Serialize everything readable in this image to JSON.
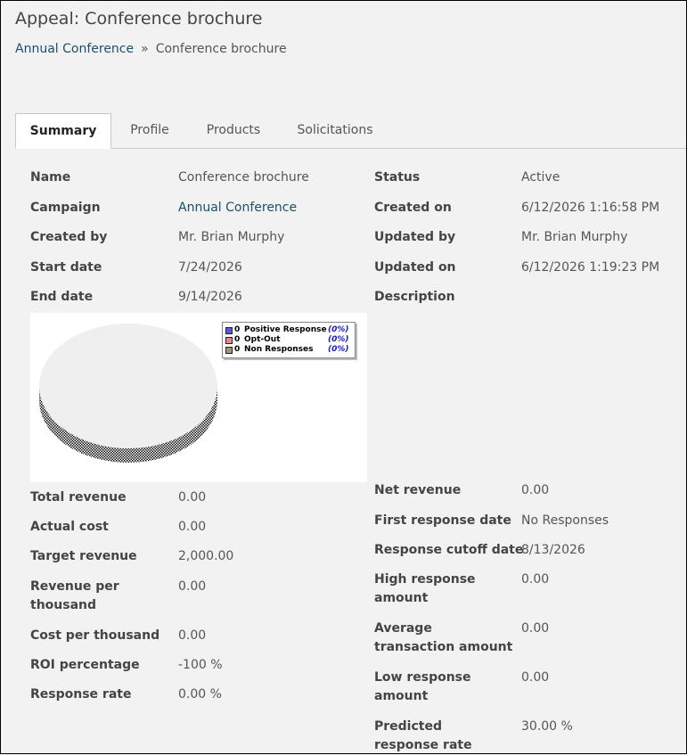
{
  "page": {
    "title": "Appeal: Conference brochure",
    "breadcrumb": {
      "parent": "Annual Conference",
      "separator": "»",
      "current": "Conference brochure"
    }
  },
  "tabs": [
    "Summary",
    "Profile",
    "Products",
    "Solicitations"
  ],
  "active_tab": "Summary",
  "fields_top_left": [
    {
      "label": "Name",
      "value": "Conference brochure"
    },
    {
      "label": "Campaign",
      "value": "Annual Conference"
    },
    {
      "label": "Created by",
      "value": "Mr. Brian Murphy"
    },
    {
      "label": "Start date",
      "value": "7/24/2026"
    },
    {
      "label": "End date",
      "value": "9/14/2026"
    }
  ],
  "fields_top_right": [
    {
      "label": "Status",
      "value": "Active"
    },
    {
      "label": "Created on",
      "value": "6/12/2026 1:16:58 PM"
    },
    {
      "label": "Updated by",
      "value": "Mr. Brian Murphy"
    },
    {
      "label": "Updated on",
      "value": "6/12/2026 1:19:23 PM"
    },
    {
      "label": "Description",
      "value": ""
    }
  ],
  "chart_legend": [
    {
      "count": "0",
      "label": "Positive Response",
      "pct": "(0%)",
      "color": "#5a5ad6"
    },
    {
      "count": "0",
      "label": "Opt-Out",
      "pct": "(0%)",
      "color": "#e8888a"
    },
    {
      "count": "0",
      "label": "Non Responses",
      "pct": "(0%)",
      "color": "#9a9a70"
    }
  ],
  "chart_data": {
    "type": "pie",
    "categories": [
      "Positive Response",
      "Opt-Out",
      "Non Responses"
    ],
    "values": [
      0,
      0,
      0
    ],
    "percentages": [
      "0%",
      "0%",
      "0%"
    ],
    "title": "",
    "legend_position": "top-right"
  },
  "fields_bottom_left": [
    {
      "label": "Total revenue",
      "value": "0.00"
    },
    {
      "label": "Actual cost",
      "value": "0.00"
    },
    {
      "label": "Target revenue",
      "value": "2,000.00"
    },
    {
      "label": "Revenue per thousand",
      "value": "0.00"
    },
    {
      "label": "Cost per thousand",
      "value": "0.00"
    },
    {
      "label": "ROI percentage",
      "value": "-100 %"
    },
    {
      "label": "Response rate",
      "value": "0.00 %"
    }
  ],
  "fields_bottom_right": [
    {
      "label": "Net revenue",
      "value": "0.00"
    },
    {
      "label": "First response date",
      "value": "No Responses"
    },
    {
      "label": "Response cutoff date",
      "value": "8/13/2026"
    },
    {
      "label": "High response amount",
      "value": "0.00"
    },
    {
      "label": "Average transaction amount",
      "value": "0.00"
    },
    {
      "label": "Low response amount",
      "value": "0.00"
    },
    {
      "label": "Predicted response rate",
      "value": "30.00 %"
    }
  ]
}
